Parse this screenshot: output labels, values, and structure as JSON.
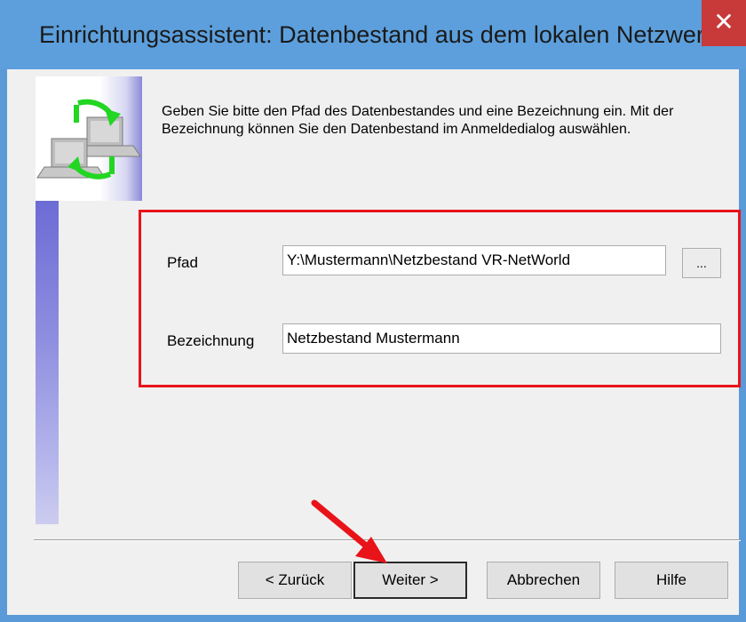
{
  "window": {
    "title": "Einrichtungsassistent: Datenbestand aus dem lokalen Netzwerk",
    "close_glyph": "✕"
  },
  "intro": {
    "text": "Geben Sie bitte den Pfad des Datenbestandes und eine Bezeichnung ein. Mit der Bezeichnung können Sie den Datenbestand im Anmeldedialog auswählen."
  },
  "form": {
    "path_label": "Pfad",
    "path_value": "Y:\\Mustermann\\Netzbestand VR-NetWorld",
    "browse_label": "...",
    "name_label": "Bezeichnung",
    "name_value": "Netzbestand Mustermann"
  },
  "buttons": {
    "back": "< Zurück",
    "next": "Weiter >",
    "cancel": "Abbrechen",
    "help": "Hilfe"
  },
  "colors": {
    "titlebar": "#5c9fdc",
    "close": "#c8393a",
    "highlight": "#e8141a",
    "arrow": "#e8141a"
  },
  "icons": {
    "wizard": "network-sync-icon",
    "annotation": "red-arrow-icon"
  }
}
